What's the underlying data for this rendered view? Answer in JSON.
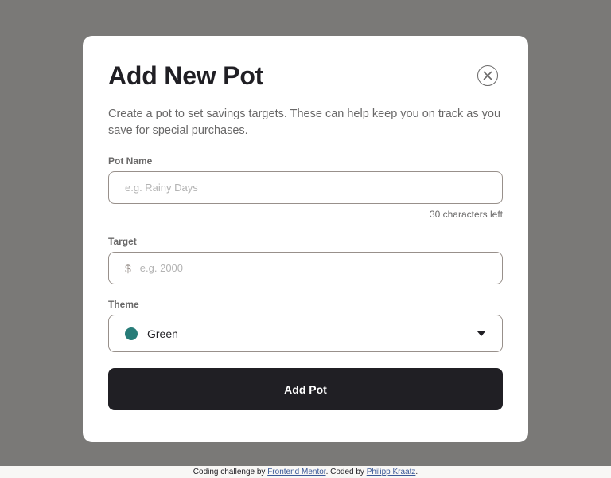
{
  "modal": {
    "title": "Add New Pot",
    "description": "Create a pot to set savings targets. These can help keep you on track as you save for special purchases.",
    "close_icon": "close-circle-icon"
  },
  "pot_name": {
    "label": "Pot Name",
    "placeholder": "e.g. Rainy Days",
    "value": "",
    "chars_left": "30 characters left"
  },
  "target": {
    "label": "Target",
    "currency": "$",
    "placeholder": "e.g. 2000",
    "value": ""
  },
  "theme": {
    "label": "Theme",
    "selected": "Green",
    "color": "#277c78",
    "chevron_icon": "caret-down-icon"
  },
  "submit_label": "Add Pot",
  "footer": {
    "prefix": "Coding challenge by ",
    "link1": "Frontend Mentor",
    "middle": ". Coded by ",
    "link2": "Philipp Kraatz",
    "suffix": "."
  },
  "colors": {
    "backdrop": "#7a7977",
    "modal_bg": "#ffffff",
    "button_bg": "#201f24",
    "text_muted": "#696868"
  }
}
